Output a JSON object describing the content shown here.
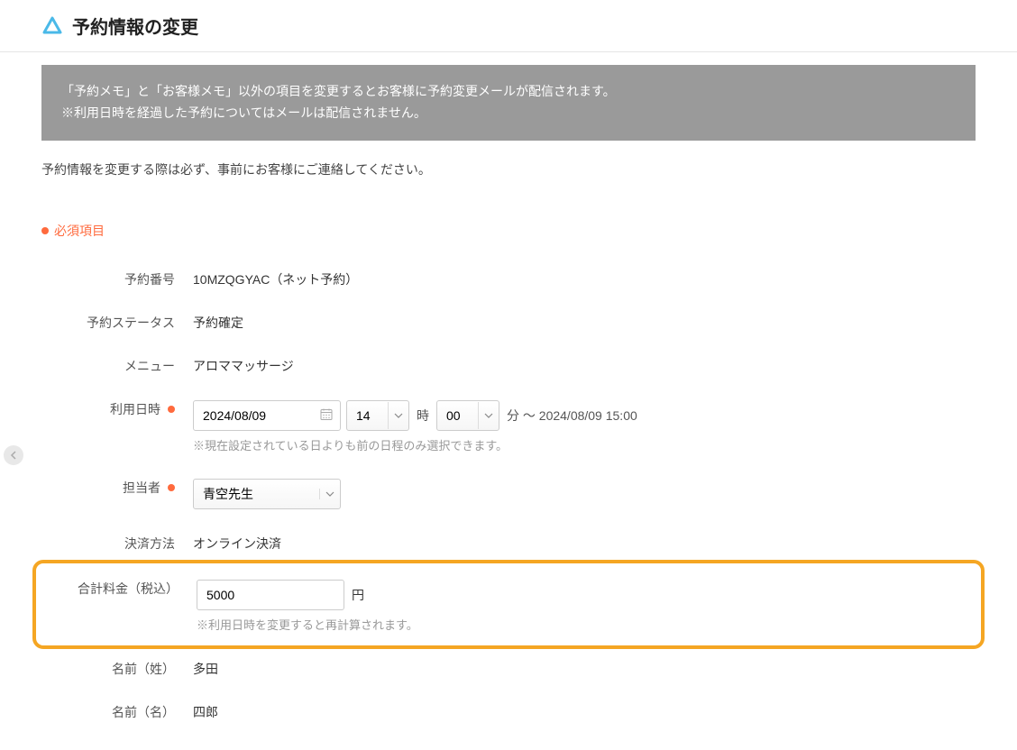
{
  "header": {
    "title": "予約情報の変更"
  },
  "banner": {
    "line1": "「予約メモ」と「お客様メモ」以外の項目を変更するとお客様に予約変更メールが配信されます。",
    "line2": "※利用日時を経過した予約についてはメールは配信されません。"
  },
  "instruction": "予約情報を変更する際は必ず、事前にお客様にご連絡してください。",
  "required_label": "必須項目",
  "labels": {
    "reservation_number": "予約番号",
    "reservation_status": "予約ステータス",
    "menu": "メニュー",
    "datetime": "利用日時",
    "staff": "担当者",
    "payment": "決済方法",
    "total": "合計料金（税込）",
    "lastname": "名前（姓）",
    "firstname": "名前（名）"
  },
  "values": {
    "reservation_number": "10MZQGYAC（ネット予約）",
    "reservation_status": "予約確定",
    "menu": "アロママッサージ",
    "date": "2024/08/09",
    "hour": "14",
    "minute": "00",
    "unit_hour": "時",
    "unit_minute_and_end": "分 〜 2024/08/09 15:00",
    "datetime_hint": "※現在設定されている日よりも前の日程のみ選択できます。",
    "staff": "青空先生",
    "payment": "オンライン決済",
    "total": "5000",
    "currency": "円",
    "total_hint": "※利用日時を変更すると再計算されます。",
    "lastname": "多田",
    "firstname": "四郎"
  }
}
